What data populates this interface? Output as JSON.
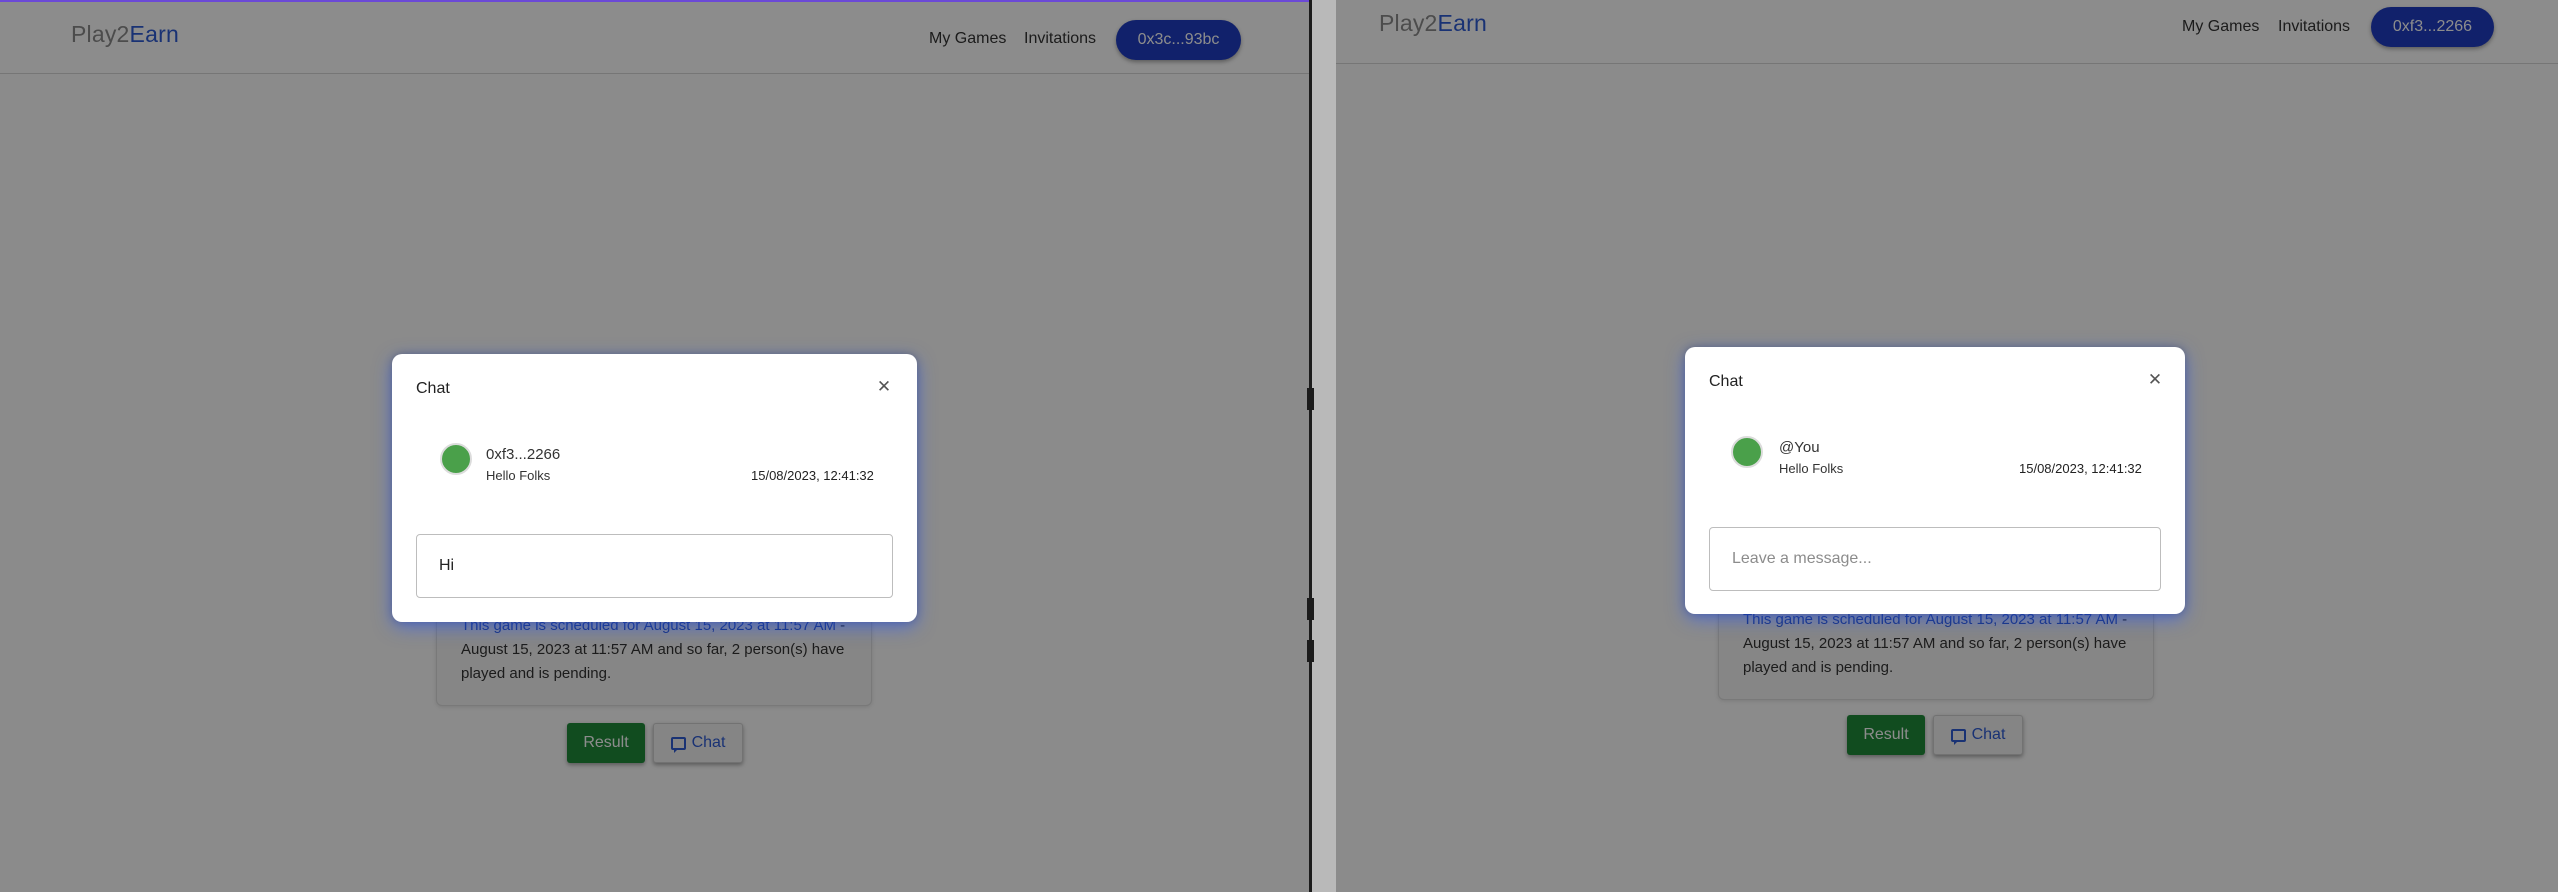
{
  "left_window": {
    "brand": {
      "play": "Play",
      "two": "2",
      "earn": "Earn"
    },
    "nav": {
      "my_games": "My Games",
      "invitations": "Invitations"
    },
    "wallet_label": "0x3c...93bc",
    "game_card": {
      "prefix": "This game is scheduled for",
      "date_link": "August 15, 2023 at 11:57 AM",
      "mid": "- August 15, 2023 at 11:57 AM",
      "suffix": "and so far, 2 person(s) have played and is pending."
    },
    "buttons": {
      "result": "Result",
      "chat": "Chat"
    },
    "chat_modal": {
      "title": "Chat",
      "message": {
        "sender": "0xf3...2266",
        "text": "Hello Folks",
        "time": "15/08/2023, 12:41:32"
      },
      "input_value": "Hi"
    }
  },
  "right_window": {
    "brand": {
      "play": "Play",
      "two": "2",
      "earn": "Earn"
    },
    "nav": {
      "my_games": "My Games",
      "invitations": "Invitations"
    },
    "wallet_label": "0xf3...2266",
    "game_card": {
      "prefix": "This game is scheduled for",
      "date_link": "August 15, 2023 at 11:57 AM",
      "mid": "- August 15, 2023 at 11:57 AM",
      "suffix": "and so far, 2 person(s) have played and is pending."
    },
    "buttons": {
      "result": "Result",
      "chat": "Chat"
    },
    "chat_modal": {
      "title": "Chat",
      "message": {
        "sender": "@You",
        "text": "Hello Folks",
        "time": "15/08/2023, 12:41:32"
      },
      "input_placeholder": "Leave a message..."
    }
  },
  "colors": {
    "brand_accent": "#2f5bd3",
    "wallet": "#1f3cc3",
    "result": "#1f8a3a",
    "avatar": "#4aa04a"
  }
}
